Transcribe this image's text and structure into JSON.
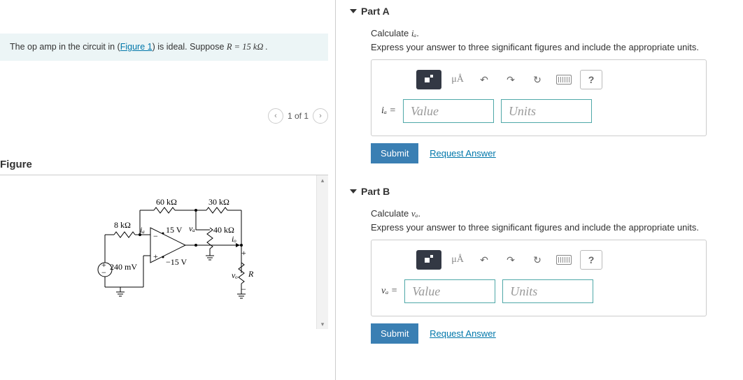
{
  "problem": {
    "prefix": "The op amp in the circuit in (",
    "figure_link": "Figure 1",
    "suffix": ") is ideal. Suppose ",
    "equation": "R = 15  kΩ ."
  },
  "figure": {
    "label": "Figure",
    "nav_text": "1 of 1",
    "r1": "60 kΩ",
    "r2": "30 kΩ",
    "r3": "8 kΩ",
    "r4": "40 kΩ",
    "vpos": "15 V",
    "vneg": "−15 V",
    "vin": "240 mV",
    "ia": "iₐ",
    "va": "vₐ",
    "io": "iₒ",
    "vo": "vₒ",
    "Rload": "R"
  },
  "partA": {
    "title": "Part A",
    "prompt_prefix": "Calculate ",
    "prompt_var": "iₐ",
    "prompt_suffix": ".",
    "instruction": "Express your answer to three significant figures and include the appropriate units.",
    "lhs": "iₐ =",
    "value_ph": "Value",
    "units_ph": "Units",
    "toolbar_mu": "μÅ",
    "submit": "Submit",
    "request": "Request Answer",
    "help": "?"
  },
  "partB": {
    "title": "Part B",
    "prompt_prefix": "Calculate ",
    "prompt_var": "vₐ",
    "prompt_suffix": ".",
    "instruction": "Express your answer to three significant figures and include the appropriate units.",
    "lhs": "vₐ =",
    "value_ph": "Value",
    "units_ph": "Units",
    "toolbar_mu": "μÅ",
    "submit": "Submit",
    "request": "Request Answer",
    "help": "?"
  }
}
